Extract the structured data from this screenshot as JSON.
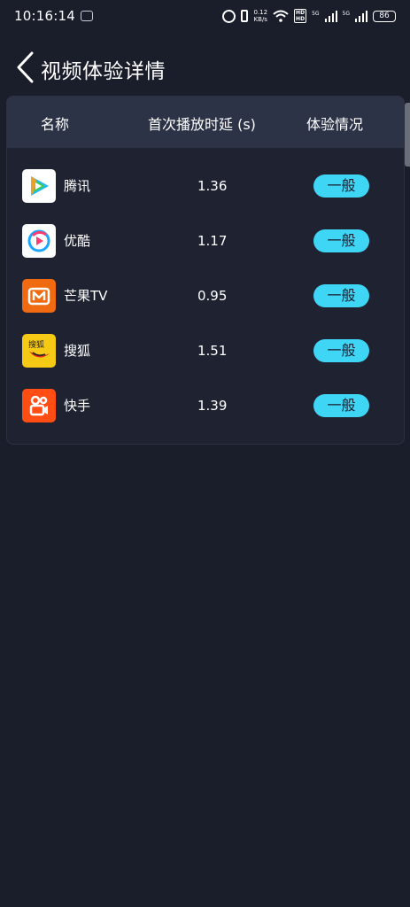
{
  "status_bar": {
    "time": "10:16:14",
    "speed_value": "0.12",
    "speed_unit": "KB/s",
    "hd1": "HD",
    "hd2": "HD",
    "net1": "5G",
    "net2": "5G",
    "battery": "86"
  },
  "header": {
    "title": "视频体验详情"
  },
  "table": {
    "columns": [
      "名称",
      "首次播放时延 (s)",
      "体验情况"
    ],
    "rows": [
      {
        "name": "腾讯",
        "latency": "1.36",
        "rating": "一般",
        "icon": "tencent-video-icon",
        "icon_color": "#ffffff"
      },
      {
        "name": "优酷",
        "latency": "1.17",
        "rating": "一般",
        "icon": "youku-icon",
        "icon_color": "#ffffff"
      },
      {
        "name": "芒果TV",
        "latency": "0.95",
        "rating": "一般",
        "icon": "mango-tv-icon",
        "icon_color": "#ef6a10"
      },
      {
        "name": "搜狐",
        "latency": "1.51",
        "rating": "一般",
        "icon": "sohu-icon",
        "icon_color": "#f6c914",
        "icon_text": "搜狐"
      },
      {
        "name": "快手",
        "latency": "1.39",
        "rating": "一般",
        "icon": "kuaishou-icon",
        "icon_color": "#ff4d14"
      }
    ]
  },
  "colors": {
    "background": "#1a1e2b",
    "card": "#1f2331",
    "table_header": "#2c3346",
    "badge": "#3fd5f5"
  }
}
